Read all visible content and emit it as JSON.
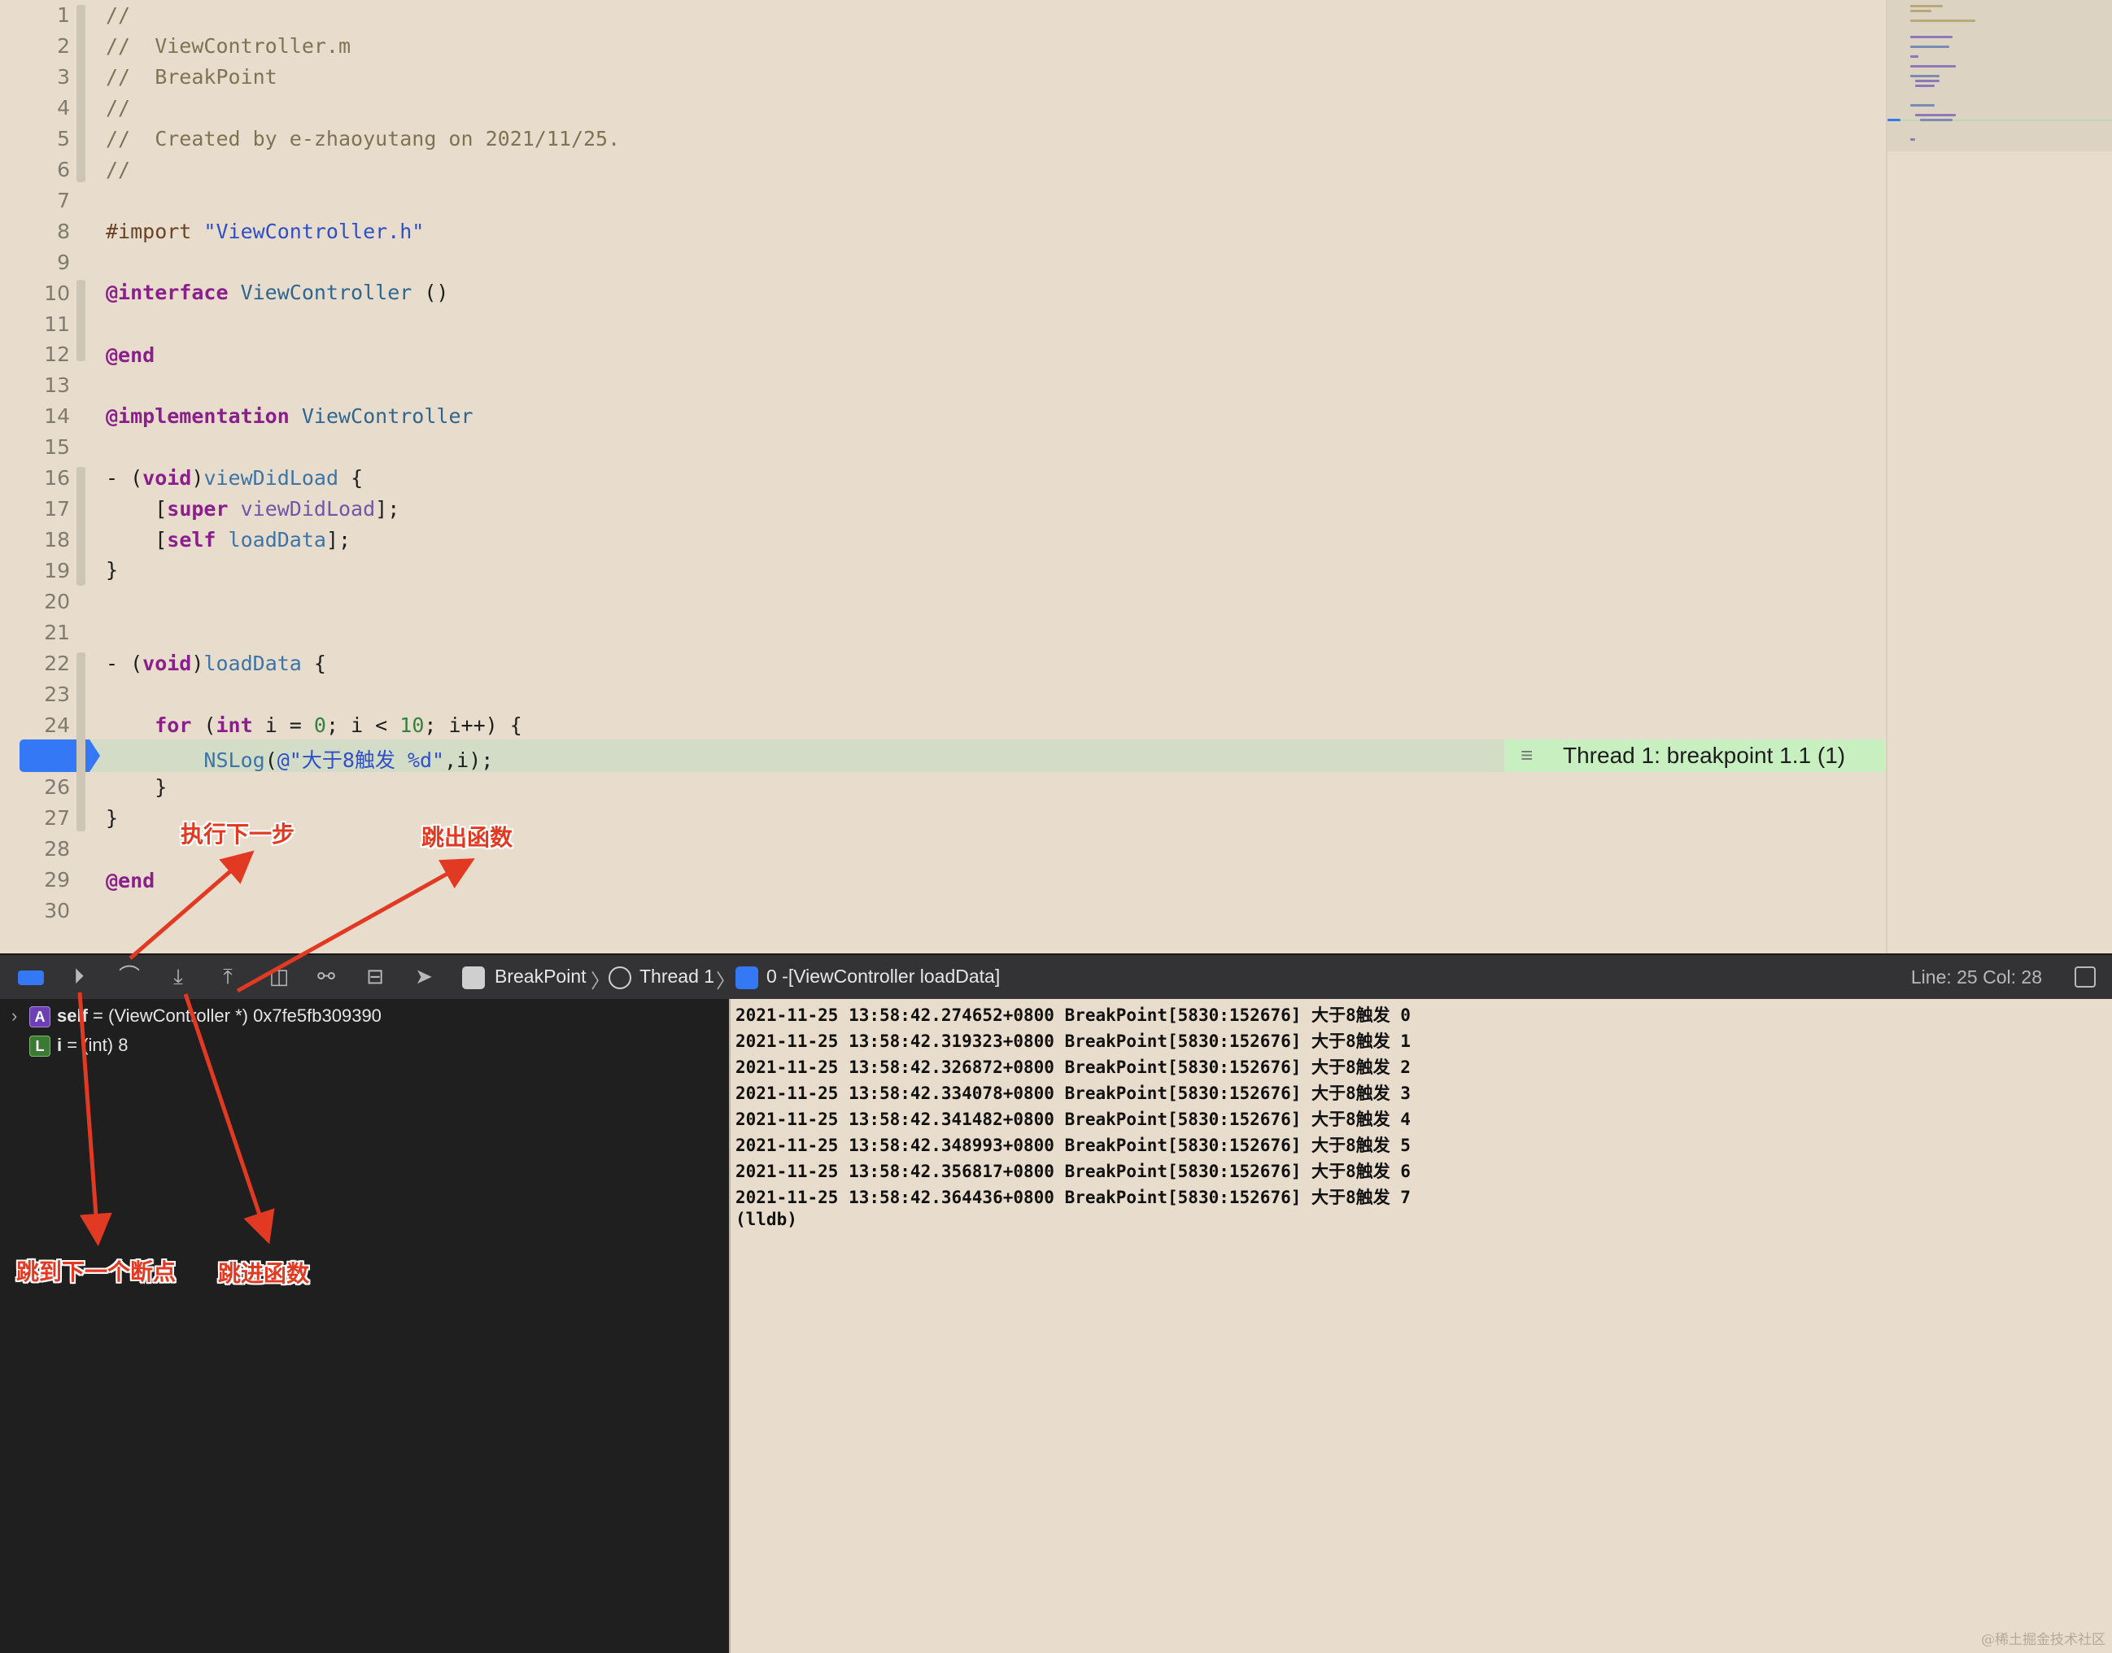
{
  "editor": {
    "line_numbers": [
      "1",
      "2",
      "3",
      "4",
      "5",
      "6",
      "7",
      "8",
      "9",
      "10",
      "11",
      "12",
      "13",
      "14",
      "15",
      "16",
      "17",
      "18",
      "19",
      "20",
      "21",
      "22",
      "23",
      "24",
      "25",
      "26",
      "27",
      "28",
      "29",
      "30"
    ],
    "active_line": "25",
    "code": {
      "l1": "//",
      "l2": "//  ViewController.m",
      "l3": "//  BreakPoint",
      "l4": "//",
      "l5": "//  Created by e-zhaoyutang on 2021/11/25.",
      "l6": "//",
      "l8_directive": "#import",
      "l8_file": "\"ViewController.h\"",
      "l10_kw": "@interface",
      "l10_cls": "ViewController",
      "l10_rest": " ()",
      "l12": "@end",
      "l14_kw": "@implementation",
      "l14_cls": "ViewController",
      "l16_a": "- (",
      "l16_kw": "void",
      "l16_b": ")",
      "l16_fn": "viewDidLoad",
      "l16_c": " {",
      "l17_a": "    [",
      "l17_kw": "super",
      "l17_fn": "viewDidLoad",
      "l17_b": "];",
      "l18_a": "    [",
      "l18_kw": "self",
      "l18_fn": "loadData",
      "l18_b": "];",
      "l19": "}",
      "l22_a": "- (",
      "l22_kw": "void",
      "l22_b": ")",
      "l22_fn": "loadData",
      "l22_c": " {",
      "l24_a": "    ",
      "l24_for": "for",
      "l24_b": " (",
      "l24_int": "int",
      "l24_c": " i = ",
      "l24_zero": "0",
      "l24_d": "; i < ",
      "l24_ten": "10",
      "l24_e": "; i++) {",
      "l25_a": "        ",
      "l25_fn": "NSLog",
      "l25_b": "(",
      "l25_str": "@\"大于8触发 %d\"",
      "l25_c": ",i);",
      "l26": "    }",
      "l27": "}",
      "l29": "@end"
    },
    "thread_badge": "Thread 1: breakpoint 1.1 (1)"
  },
  "debugbar": {
    "breadcrumb_target": "BreakPoint",
    "breadcrumb_thread": "Thread 1",
    "breadcrumb_frame": "0 -[ViewController loadData]",
    "line_col": "Line: 25  Col: 28",
    "icons": [
      "breakpoints-toggle-icon",
      "continue-icon",
      "step-over-icon",
      "step-into-icon",
      "step-out-icon",
      "view-hierarchy-icon",
      "memory-graph-icon",
      "environment-overrides-icon",
      "simulate-location-icon"
    ]
  },
  "variables": [
    {
      "tag": "A",
      "name": "self",
      "value": "= (ViewController *) 0x7fe5fb309390"
    },
    {
      "tag": "L",
      "name": "i",
      "value": "= (int) 8"
    }
  ],
  "console": {
    "lines": [
      "2021-11-25 13:58:42.274652+0800 BreakPoint[5830:152676] 大于8触发 0",
      "2021-11-25 13:58:42.319323+0800 BreakPoint[5830:152676] 大于8触发 1",
      "2021-11-25 13:58:42.326872+0800 BreakPoint[5830:152676] 大于8触发 2",
      "2021-11-25 13:58:42.334078+0800 BreakPoint[5830:152676] 大于8触发 3",
      "2021-11-25 13:58:42.341482+0800 BreakPoint[5830:152676] 大于8触发 4",
      "2021-11-25 13:58:42.348993+0800 BreakPoint[5830:152676] 大于8触发 5",
      "2021-11-25 13:58:42.356817+0800 BreakPoint[5830:152676] 大于8触发 6",
      "2021-11-25 13:58:42.364436+0800 BreakPoint[5830:152676] 大于8触发 7",
      "(lldb)"
    ]
  },
  "annotations": {
    "step_over": "执行下一步",
    "step_out": "跳出函数",
    "continue": "跳到下一个断点",
    "step_into": "跳进函数",
    "color": "#e23a22"
  },
  "watermark": "@稀土掘金技术社区",
  "colors": {
    "editor_bg": "#e8ddcc",
    "breakpoint": "#3478f6",
    "thread_badge": "#c8efc0",
    "debug_bar": "#333335",
    "variables_bg": "#1f1f1f"
  }
}
